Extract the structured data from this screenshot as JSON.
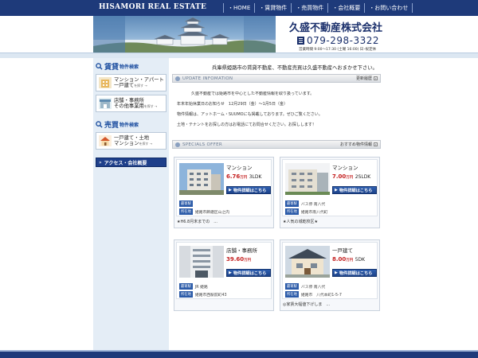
{
  "topbar": {
    "brand": "HISAMORI REAL ESTATE",
    "nav": [
      "HOME",
      "賃貸物件",
      "売買物件",
      "会社概要",
      "お問い合わせ"
    ]
  },
  "header": {
    "company": "久盛不動産株式会社",
    "phone": "079-298-3322",
    "hours": "営業時間 9:00～17:30 (土曜 16:00) 日･祝定休"
  },
  "sidebar": {
    "rent": {
      "title": "賃貸",
      "sub": "物件検索",
      "items": [
        {
          "line1": "マンション・アパート",
          "line2": "一戸建て",
          "go": "を探す →"
        },
        {
          "line1": "店舗・事務所",
          "line2": "その他事業用",
          "go": "を探す →"
        }
      ]
    },
    "sale": {
      "title": "売買",
      "sub": "物件検索",
      "items": [
        {
          "line1": "一戸建て・土地",
          "line2": "マンション",
          "go": "を探す →"
        }
      ]
    },
    "access": "アクセス・会社概要"
  },
  "main": {
    "tagline": "兵庫県姫路市の賃貸不動産、不動産売買は久盛不動産へおまかせ下さい。",
    "update": {
      "title": "UPDATE INFOMATION",
      "link": "更新履歴",
      "news": [
        "久盛不動産では姫路市を中心とした不動産情報を取り扱っています。",
        "年末年始休業日のお知らせ　12月29日（金）～1月5日（金）",
        "物件情報は、アットホーム・SUUMOにも掲載しております。ぜひご覧ください。",
        "土地・テナントをお探しの方はお電話にてお問合せください。お探しします！"
      ]
    },
    "specials": {
      "title": "SPECIALS OFFER",
      "link": "おすすめ物件情報",
      "detail_label": "物件詳細はこちら",
      "tags": {
        "station": "最寄駅",
        "address": "所在地"
      },
      "cards": [
        {
          "type": "マンション",
          "price": "6.76",
          "unit": "万円",
          "layout": "3LDK",
          "station": "",
          "address": "姫路市飾磨区山之内",
          "note": "★H6.8月末までの　..."
        },
        {
          "type": "マンション",
          "price": "7.00",
          "unit": "万円",
          "layout": "2SLDK",
          "station": "バス停 南八代",
          "address": "姫路市南八代町",
          "note": "★人気の城乾校区★"
        },
        {
          "type": "店舗・事務所",
          "price": "39.60",
          "unit": "万円",
          "layout": "",
          "station": "JR 姫路",
          "address": "姫路市西駅前町43",
          "note": ""
        },
        {
          "type": "一戸建て",
          "price": "8.00",
          "unit": "万円",
          "layout": "5DK",
          "station": "バス停 南八代",
          "address": "姫路市　八代本町1-5-7",
          "note": "◎家賃大幅値下げしま　..."
        }
      ]
    }
  },
  "colors": {
    "navy": "#1e3a7a",
    "price": "#c41f1f",
    "sidebar": "#e4edf6"
  }
}
